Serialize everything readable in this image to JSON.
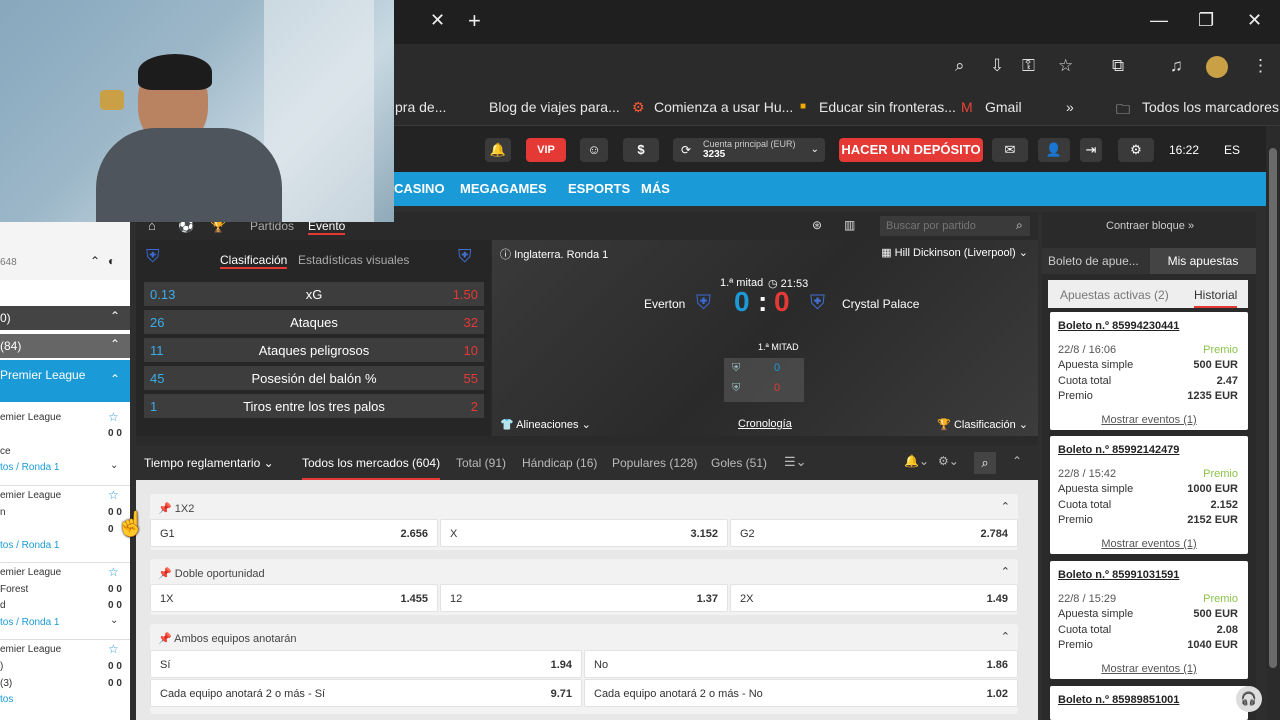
{
  "browser": {
    "bookmarks": [
      "pra de...",
      "Blog de viajes para...",
      "Comienza a usar Hu...",
      "Educar sin fronteras...",
      "Gmail",
      "Todos los marcadores"
    ]
  },
  "header": {
    "vip_label": "VIP",
    "account_label": "Cuenta principal (EUR)",
    "account_value": "3235",
    "deposit_label": "HACER UN DEPÓSITO",
    "time": "16:22",
    "lang": "ES"
  },
  "nav": {
    "items": [
      "CASINO",
      "MEGAGAMES",
      "ESPORTS",
      "MÁS"
    ]
  },
  "breadcrumb": {
    "tab_matches": "Partidos",
    "tab_event": "Evento",
    "search_placeholder": "Buscar por partido"
  },
  "stats": {
    "tab_class": "Clasificación",
    "tab_visual": "Estadísticas visuales",
    "rows": [
      {
        "left": "0.13",
        "label": "xG",
        "right": "1.50"
      },
      {
        "left": "26",
        "label": "Ataques",
        "right": "32"
      },
      {
        "left": "11",
        "label": "Ataques peligrosos",
        "right": "10"
      },
      {
        "left": "45",
        "label": "Posesión del balón %",
        "right": "55"
      },
      {
        "left": "1",
        "label": "Tiros entre los tres palos",
        "right": "2"
      }
    ]
  },
  "match": {
    "league": "Inglaterra. Ronda 1",
    "venue": "Hill Dickinson (Liverpool)",
    "period": "1.ª mitad",
    "clock": "21:53",
    "home": "Everton",
    "away": "Crystal Palace",
    "home_score": "0",
    "away_score": "0",
    "mini_period": "1.ª MITAD",
    "mini_home": "0",
    "mini_away": "0",
    "lineups": "Alineaciones",
    "timeline": "Cronología",
    "standings": "Clasificación"
  },
  "market_tabs": {
    "period": "Tiempo reglamentario",
    "items": [
      "Todos los mercados (604)",
      "Total (91)",
      "Hándicap (16)",
      "Populares (128)",
      "Goles (51)"
    ]
  },
  "markets": [
    {
      "title": "1X2",
      "odds": [
        {
          "n": "G1",
          "v": "2.656"
        },
        {
          "n": "X",
          "v": "3.152"
        },
        {
          "n": "G2",
          "v": "2.784"
        }
      ]
    },
    {
      "title": "Doble oportunidad",
      "odds": [
        {
          "n": "1X",
          "v": "1.455"
        },
        {
          "n": "12",
          "v": "1.37"
        },
        {
          "n": "2X",
          "v": "1.49"
        }
      ]
    },
    {
      "title": "Ambos equipos anotarán",
      "odds": [
        {
          "n": "Sí",
          "v": "1.94"
        },
        {
          "n": "No",
          "v": "1.86"
        },
        {
          "n": "Cada equipo anotará 2 o más - Sí",
          "v": "9.71"
        },
        {
          "n": "Cada equipo anotará 2 o más - No",
          "v": "1.02"
        }
      ]
    }
  ],
  "right": {
    "collapse": "Contraer bloque",
    "tab_slip": "Boleto de apue...",
    "tab_bets": "Mis apuestas",
    "sub_active": "Apuestas activas (2)",
    "sub_history": "Historial",
    "tickets": [
      {
        "id": "Boleto n.º 85994230441",
        "date": "22/8 / 16:06",
        "status": "Premio",
        "type": "Apuesta simple",
        "amount": "500 EUR",
        "odds_label": "Cuota total",
        "odds": "2.47",
        "prize_label": "Premio",
        "prize": "1235 EUR",
        "more": "Mostrar eventos (1)"
      },
      {
        "id": "Boleto n.º 85992142479",
        "date": "22/8 / 15:42",
        "status": "Premio",
        "type": "Apuesta simple",
        "amount": "1000 EUR",
        "odds_label": "Cuota total",
        "odds": "2.152",
        "prize_label": "Premio",
        "prize": "2152 EUR",
        "more": "Mostrar eventos (1)"
      },
      {
        "id": "Boleto n.º 85991031591",
        "date": "22/8 / 15:29",
        "status": "Premio",
        "type": "Apuesta simple",
        "amount": "500 EUR",
        "odds_label": "Cuota total",
        "odds": "2.08",
        "prize_label": "Premio",
        "prize": "1040 EUR",
        "more": "Mostrar eventos (1)"
      },
      {
        "id": "Boleto n.º 85989851001"
      }
    ]
  },
  "left": {
    "count_top": "648",
    "group1": "0)",
    "group2": "(84)",
    "league": "Premier League",
    "matches": [
      {
        "league": "emier League",
        "t1": "",
        "t2": "ce",
        "s1": "0 0",
        "s2": "",
        "round": "tos / Ronda 1"
      },
      {
        "league": "emier League",
        "t1": "n",
        "t2": "",
        "s1": "0 0",
        "s2": "0",
        "round": "tos / Ronda 1"
      },
      {
        "league": "emier League",
        "t1": "Forest",
        "t2": "d",
        "s1": "0 0",
        "s2": "0 0",
        "round": "tos / Ronda 1"
      },
      {
        "league": "emier League",
        "t1": ")",
        "t2": "(3)",
        "s1": "0 0",
        "s2": "0 0",
        "round": "tos"
      }
    ]
  }
}
